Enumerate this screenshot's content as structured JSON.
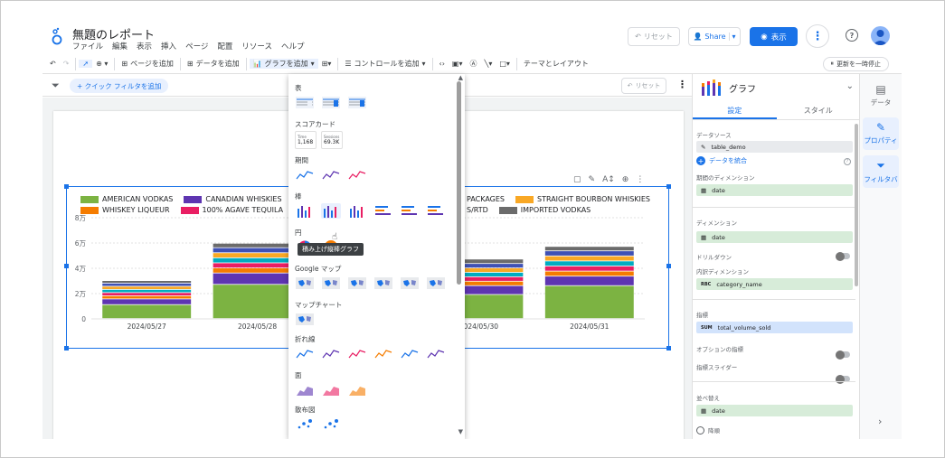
{
  "header": {
    "title": "無題のレポート",
    "menu": [
      "ファイル",
      "編集",
      "表示",
      "挿入",
      "ページ",
      "配置",
      "リソース",
      "ヘルプ"
    ],
    "reset_label": "リセット",
    "share_label": "Share",
    "view_label": "表示",
    "brand_color": "#1a73e8"
  },
  "toolbar": {
    "add_page": "ページを追加",
    "add_data": "データを追加",
    "add_chart": "グラフを追加",
    "add_control": "コントロールを追加",
    "theme_layout": "テーマとレイアウト",
    "pause_updates": "更新を一時停止"
  },
  "subbar": {
    "quick_filter": "+ クイック フィルタを追加",
    "reset": "リセット"
  },
  "chart_data": {
    "type": "bar",
    "stacked": true,
    "categories": [
      "2024/05/27",
      "2024/05/28",
      "2024/05/29",
      "2024/05/30",
      "2024/05/31"
    ],
    "yticks": [
      "8万",
      "6万",
      "4万",
      "2万",
      "0"
    ],
    "ylim": [
      0,
      80000
    ],
    "grid": true,
    "legend_position": "top",
    "series": [
      {
        "name": "AMERICAN VODKAS",
        "color": "#7cb342",
        "values": [
          11000,
          27000,
          21000,
          19000,
          26000
        ]
      },
      {
        "name": "CANADIAN WHISKIES",
        "color": "#5e35b1",
        "values": [
          4500,
          9000,
          8000,
          7000,
          7500
        ]
      },
      {
        "name": "WHISKEY LIQUEUR",
        "color": "#f57c00",
        "values": [
          2500,
          4000,
          3500,
          3500,
          4000
        ]
      },
      {
        "name": "100% AGAVE TEQUILA",
        "color": "#e91e63",
        "values": [
          2500,
          4000,
          3500,
          3500,
          4000
        ]
      },
      {
        "name": "PACKAGES",
        "color": "#00acc1",
        "values": [
          2500,
          4000,
          3500,
          3500,
          4000
        ]
      },
      {
        "name": "STRAIGHT BOURBON WHISKIES",
        "color": "#f9a825",
        "values": [
          2500,
          4000,
          3500,
          3500,
          4000
        ]
      },
      {
        "name": "S/RTD",
        "color": "#3f51b5",
        "values": [
          2500,
          4000,
          3500,
          3500,
          4000
        ]
      },
      {
        "name": "IMPORTED VODKAS",
        "color": "#6b6b6b",
        "values": [
          2000,
          3500,
          3000,
          3500,
          3500
        ]
      }
    ]
  },
  "dropdown": {
    "sections": [
      "表",
      "スコアカード",
      "期間",
      "棒",
      "円",
      "Google マップ",
      "マップチャート",
      "折れ線",
      "面",
      "散布図"
    ],
    "scorecard_1_label": "Time",
    "scorecard_1_value": "1,168",
    "scorecard_2_label": "Sessions",
    "scorecard_2_value": "69.3K",
    "tooltip": "積み上げ縦棒グラフ"
  },
  "right_panel": {
    "title": "グラフ",
    "tabs": [
      "設定",
      "スタイル"
    ],
    "datasource_label": "データソース",
    "datasource_name": "table_demo",
    "blend_label": "データを統合",
    "date_range_dim_label": "期間のディメンション",
    "date_chip": "date",
    "dimension_label": "ディメンション",
    "drilldown_label": "ドリルダウン",
    "breakdown_label": "内訳ディメンション",
    "breakdown_chip": "category_name",
    "metric_label": "指標",
    "metric_chip": "total_volume_sold",
    "optional_metric_label": "オプションの指標",
    "metric_slider_label": "指標スライダー",
    "sort_label": "並べ替え",
    "sort_chip": "date",
    "rbc_badge": "RBC",
    "sum_badge": "SUM",
    "desc_label": "降順"
  },
  "side": {
    "data": "データ",
    "properties": "プロパティ",
    "filter": "フィルタバ"
  }
}
